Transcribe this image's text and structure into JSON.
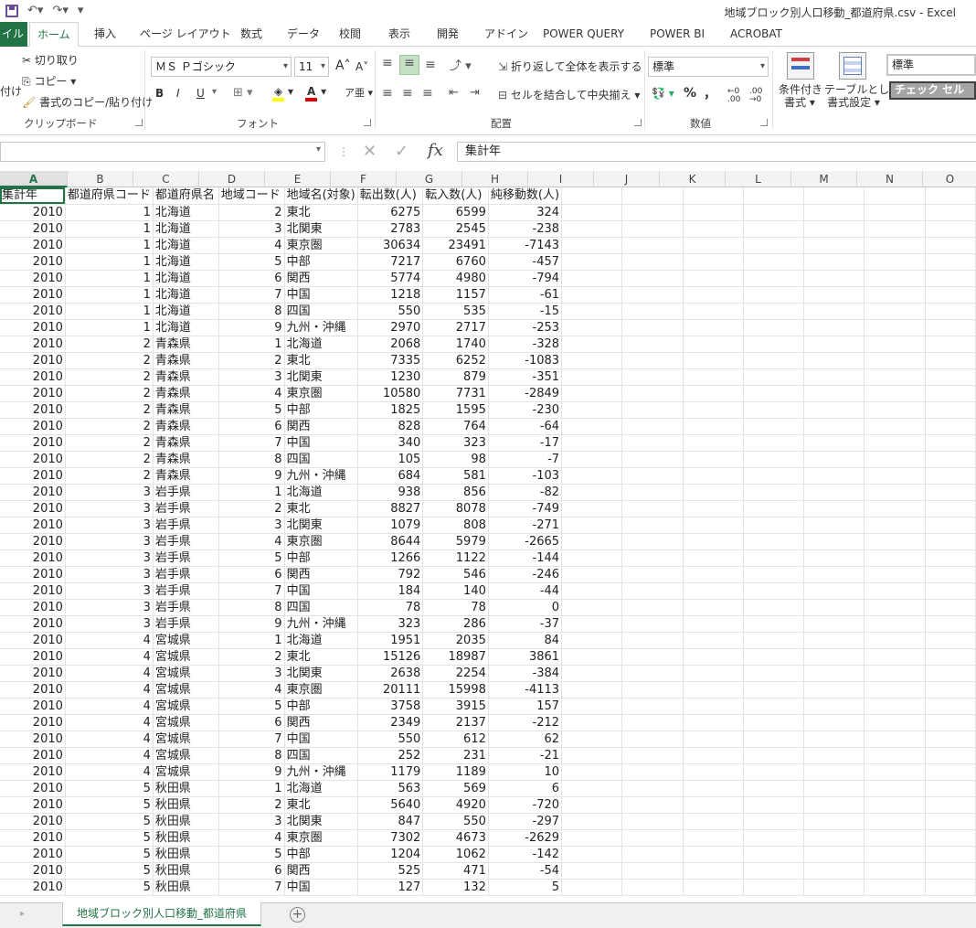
{
  "window": {
    "title": "地域ブロック別人口移動_都道府県.csv - Excel"
  },
  "tabs": [
    {
      "label": "イル",
      "key": "file"
    },
    {
      "label": "ホーム",
      "key": "home"
    },
    {
      "label": "挿入",
      "key": "insert"
    },
    {
      "label": "ページ レイアウト",
      "key": "layout"
    },
    {
      "label": "数式",
      "key": "formulas"
    },
    {
      "label": "データ",
      "key": "data"
    },
    {
      "label": "校閲",
      "key": "review"
    },
    {
      "label": "表示",
      "key": "view"
    },
    {
      "label": "開発",
      "key": "dev"
    },
    {
      "label": "アドイン",
      "key": "addins"
    },
    {
      "label": "POWER QUERY",
      "key": "pq"
    },
    {
      "label": "POWER BI",
      "key": "pbi"
    },
    {
      "label": "ACROBAT",
      "key": "acrobat"
    }
  ],
  "ribbon": {
    "clipboard": {
      "paste": "付け",
      "cut": "切り取り",
      "copy": "コピー",
      "format_painter": "書式のコピー/貼り付け",
      "label": "クリップボード"
    },
    "font": {
      "name": "ＭＳ Ｐゴシック",
      "size": "11",
      "label": "フォント",
      "bold": "B",
      "italic": "I",
      "underline": "U"
    },
    "alignment": {
      "wrap": "折り返して全体を表示する",
      "merge": "セルを結合して中央揃え",
      "label": "配置"
    },
    "number": {
      "format": "標準",
      "percent": "%",
      "comma": "，",
      "label": "数値"
    },
    "styles": {
      "conditional_line1": "条件付き",
      "conditional_line2": "書式",
      "table_line1": "テーブルとして",
      "table_line2": "書式設定",
      "style_normal": "標準",
      "style_check": "チェック セル"
    }
  },
  "formula_bar": {
    "name_box": "",
    "content": "集計年"
  },
  "columns": [
    "A",
    "B",
    "C",
    "D",
    "E",
    "F",
    "G",
    "H",
    "I",
    "J",
    "K",
    "L",
    "M",
    "N",
    "O"
  ],
  "header_row": [
    "集計年",
    "都道府県コード",
    "都道府県名",
    "地域コード",
    "地域名(対象)",
    "転出数(人)",
    "転入数(人)",
    "純移動数(人)"
  ],
  "rows": [
    [
      "2010",
      "1",
      "北海道",
      "2",
      "東北",
      "6275",
      "6599",
      "324"
    ],
    [
      "2010",
      "1",
      "北海道",
      "3",
      "北関東",
      "2783",
      "2545",
      "-238"
    ],
    [
      "2010",
      "1",
      "北海道",
      "4",
      "東京圏",
      "30634",
      "23491",
      "-7143"
    ],
    [
      "2010",
      "1",
      "北海道",
      "5",
      "中部",
      "7217",
      "6760",
      "-457"
    ],
    [
      "2010",
      "1",
      "北海道",
      "6",
      "関西",
      "5774",
      "4980",
      "-794"
    ],
    [
      "2010",
      "1",
      "北海道",
      "7",
      "中国",
      "1218",
      "1157",
      "-61"
    ],
    [
      "2010",
      "1",
      "北海道",
      "8",
      "四国",
      "550",
      "535",
      "-15"
    ],
    [
      "2010",
      "1",
      "北海道",
      "9",
      "九州・沖縄",
      "2970",
      "2717",
      "-253"
    ],
    [
      "2010",
      "2",
      "青森県",
      "1",
      "北海道",
      "2068",
      "1740",
      "-328"
    ],
    [
      "2010",
      "2",
      "青森県",
      "2",
      "東北",
      "7335",
      "6252",
      "-1083"
    ],
    [
      "2010",
      "2",
      "青森県",
      "3",
      "北関東",
      "1230",
      "879",
      "-351"
    ],
    [
      "2010",
      "2",
      "青森県",
      "4",
      "東京圏",
      "10580",
      "7731",
      "-2849"
    ],
    [
      "2010",
      "2",
      "青森県",
      "5",
      "中部",
      "1825",
      "1595",
      "-230"
    ],
    [
      "2010",
      "2",
      "青森県",
      "6",
      "関西",
      "828",
      "764",
      "-64"
    ],
    [
      "2010",
      "2",
      "青森県",
      "7",
      "中国",
      "340",
      "323",
      "-17"
    ],
    [
      "2010",
      "2",
      "青森県",
      "8",
      "四国",
      "105",
      "98",
      "-7"
    ],
    [
      "2010",
      "2",
      "青森県",
      "9",
      "九州・沖縄",
      "684",
      "581",
      "-103"
    ],
    [
      "2010",
      "3",
      "岩手県",
      "1",
      "北海道",
      "938",
      "856",
      "-82"
    ],
    [
      "2010",
      "3",
      "岩手県",
      "2",
      "東北",
      "8827",
      "8078",
      "-749"
    ],
    [
      "2010",
      "3",
      "岩手県",
      "3",
      "北関東",
      "1079",
      "808",
      "-271"
    ],
    [
      "2010",
      "3",
      "岩手県",
      "4",
      "東京圏",
      "8644",
      "5979",
      "-2665"
    ],
    [
      "2010",
      "3",
      "岩手県",
      "5",
      "中部",
      "1266",
      "1122",
      "-144"
    ],
    [
      "2010",
      "3",
      "岩手県",
      "6",
      "関西",
      "792",
      "546",
      "-246"
    ],
    [
      "2010",
      "3",
      "岩手県",
      "7",
      "中国",
      "184",
      "140",
      "-44"
    ],
    [
      "2010",
      "3",
      "岩手県",
      "8",
      "四国",
      "78",
      "78",
      "0"
    ],
    [
      "2010",
      "3",
      "岩手県",
      "9",
      "九州・沖縄",
      "323",
      "286",
      "-37"
    ],
    [
      "2010",
      "4",
      "宮城県",
      "1",
      "北海道",
      "1951",
      "2035",
      "84"
    ],
    [
      "2010",
      "4",
      "宮城県",
      "2",
      "東北",
      "15126",
      "18987",
      "3861"
    ],
    [
      "2010",
      "4",
      "宮城県",
      "3",
      "北関東",
      "2638",
      "2254",
      "-384"
    ],
    [
      "2010",
      "4",
      "宮城県",
      "4",
      "東京圏",
      "20111",
      "15998",
      "-4113"
    ],
    [
      "2010",
      "4",
      "宮城県",
      "5",
      "中部",
      "3758",
      "3915",
      "157"
    ],
    [
      "2010",
      "4",
      "宮城県",
      "6",
      "関西",
      "2349",
      "2137",
      "-212"
    ],
    [
      "2010",
      "4",
      "宮城県",
      "7",
      "中国",
      "550",
      "612",
      "62"
    ],
    [
      "2010",
      "4",
      "宮城県",
      "8",
      "四国",
      "252",
      "231",
      "-21"
    ],
    [
      "2010",
      "4",
      "宮城県",
      "9",
      "九州・沖縄",
      "1179",
      "1189",
      "10"
    ],
    [
      "2010",
      "5",
      "秋田県",
      "1",
      "北海道",
      "563",
      "569",
      "6"
    ],
    [
      "2010",
      "5",
      "秋田県",
      "2",
      "東北",
      "5640",
      "4920",
      "-720"
    ],
    [
      "2010",
      "5",
      "秋田県",
      "3",
      "北関東",
      "847",
      "550",
      "-297"
    ],
    [
      "2010",
      "5",
      "秋田県",
      "4",
      "東京圏",
      "7302",
      "4673",
      "-2629"
    ],
    [
      "2010",
      "5",
      "秋田県",
      "5",
      "中部",
      "1204",
      "1062",
      "-142"
    ],
    [
      "2010",
      "5",
      "秋田県",
      "6",
      "関西",
      "525",
      "471",
      "-54"
    ],
    [
      "2010",
      "5",
      "秋田県",
      "7",
      "中国",
      "127",
      "132",
      "5"
    ]
  ],
  "sheet_tab": "地域ブロック別人口移動_都道府県",
  "add_sheet": "+"
}
